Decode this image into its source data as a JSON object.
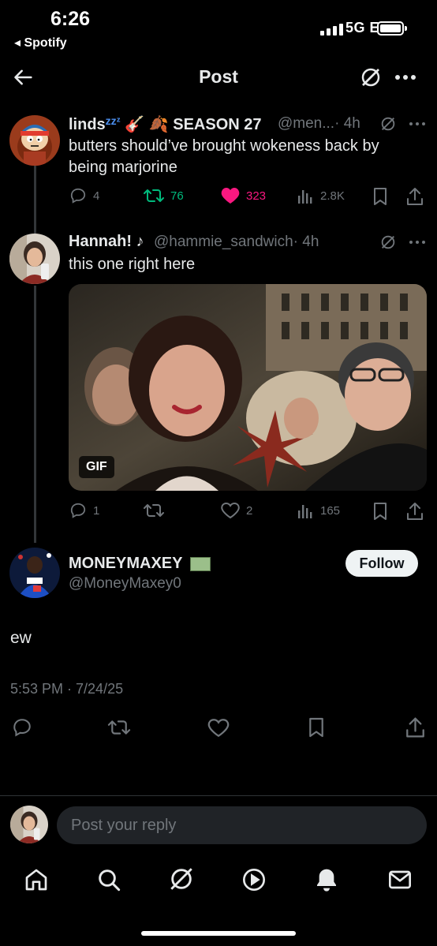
{
  "status_bar": {
    "time": "6:26",
    "back_app": "◂ Spotify",
    "network": "5G E"
  },
  "header": {
    "title": "Post"
  },
  "posts": [
    {
      "name": "linds",
      "name_suffix": "SEASON 27",
      "handle": "@men...",
      "time": "· 4h",
      "text": "butters should’ve brought wokeness back by being marjorine",
      "replies": "4",
      "reposts": "76",
      "likes": "323",
      "views": "2.8K",
      "repost_color": "#00ba7c",
      "like_color": "#f91880"
    },
    {
      "name": "Hannah! ♪",
      "handle": "@hammie_sandwich",
      "time": "· 4h",
      "text": "this one right here",
      "gif_label": "GIF",
      "replies": "1",
      "reposts": "",
      "likes": "2",
      "views": "165"
    }
  ],
  "main_post": {
    "name": "MONEYMAXEY",
    "handle": "@MoneyMaxey0",
    "follow_label": "Follow",
    "text": "ew",
    "timestamp": "5:53 PM · 7/24/25"
  },
  "reply_box": {
    "placeholder": "Post your reply"
  },
  "bottom_nav": [
    "home-icon",
    "search-icon",
    "grok-icon",
    "video-icon",
    "notifications-icon",
    "messages-icon"
  ]
}
